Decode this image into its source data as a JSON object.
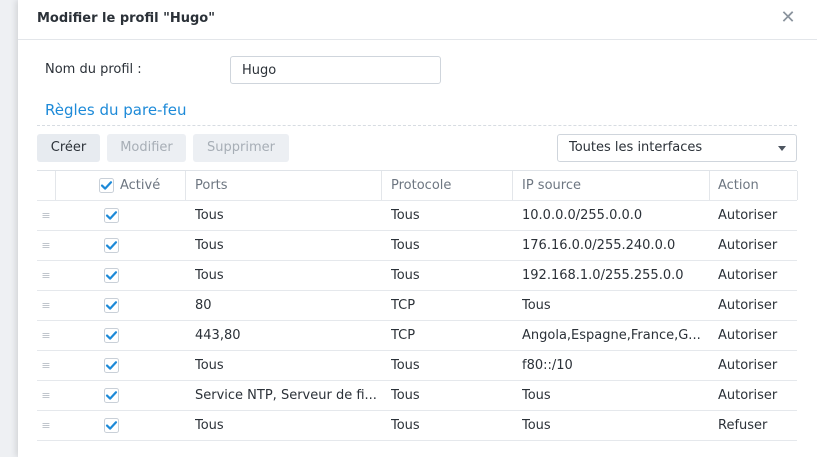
{
  "dialog": {
    "title": "Modifier le profil \"Hugo\"",
    "close_glyph": "✕"
  },
  "profile": {
    "label": "Nom du profil :",
    "value": "Hugo"
  },
  "rules_section": {
    "title": "Règles du pare-feu"
  },
  "toolbar": {
    "create_label": "Créer",
    "modify_label": "Modifier",
    "delete_label": "Supprimer",
    "interfaces_selected": "Toutes les interfaces"
  },
  "table": {
    "columns": {
      "enabled": "Activé",
      "ports": "Ports",
      "protocol": "Protocole",
      "ip_source": "IP source",
      "action": "Action"
    },
    "drag_glyph": "≡",
    "rows": [
      {
        "enabled": true,
        "ports": "Tous",
        "protocol": "Tous",
        "ip_source": "10.0.0.0/255.0.0.0",
        "action": "Autoriser"
      },
      {
        "enabled": true,
        "ports": "Tous",
        "protocol": "Tous",
        "ip_source": "176.16.0.0/255.240.0.0",
        "action": "Autoriser"
      },
      {
        "enabled": true,
        "ports": "Tous",
        "protocol": "Tous",
        "ip_source": "192.168.1.0/255.255.0.0",
        "action": "Autoriser"
      },
      {
        "enabled": true,
        "ports": "80",
        "protocol": "TCP",
        "ip_source": "Tous",
        "action": "Autoriser"
      },
      {
        "enabled": true,
        "ports": "443,80",
        "protocol": "TCP",
        "ip_source": "Angola,Espagne,France,G...",
        "action": "Autoriser"
      },
      {
        "enabled": true,
        "ports": "Tous",
        "protocol": "Tous",
        "ip_source": "f80::/10",
        "action": "Autoriser"
      },
      {
        "enabled": true,
        "ports": "Service NTP, Serveur de fi...",
        "protocol": "Tous",
        "ip_source": "Tous",
        "action": "Autoriser"
      },
      {
        "enabled": true,
        "ports": "Tous",
        "protocol": "Tous",
        "ip_source": "Tous",
        "action": "Refuser"
      }
    ]
  },
  "colors": {
    "accent": "#1d8ad8",
    "checkbox": "#1d8ad8"
  },
  "icons": {
    "close": "close-icon",
    "caret": "chevron-down-icon",
    "drag": "drag-handle-icon",
    "check": "checkmark-icon"
  }
}
